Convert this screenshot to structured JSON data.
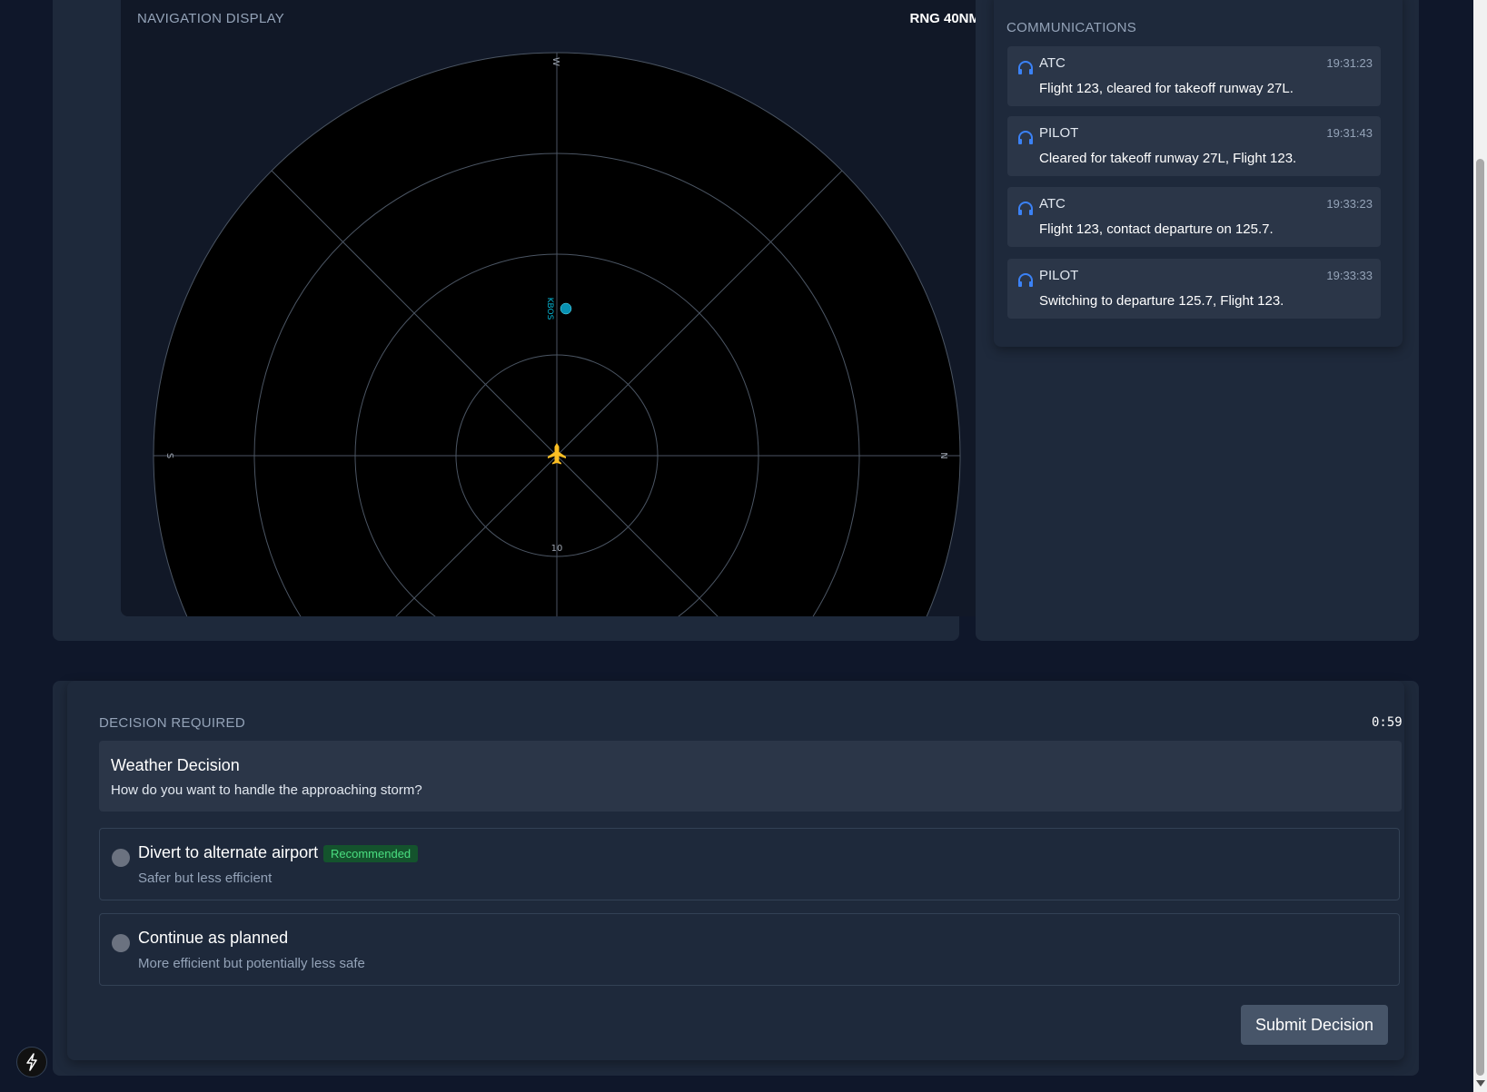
{
  "nav": {
    "title": "NAVIGATION DISPLAY",
    "range": "RNG 40NM",
    "compass": {
      "top": "W",
      "left": "S",
      "right": "N"
    },
    "ring_label": "10",
    "waypoint_label": "KBOS",
    "colors": {
      "aircraft": "#fbbf24",
      "waypoint": "#06b6d4",
      "grid": "#4b5563"
    }
  },
  "comms": {
    "title": "COMMUNICATIONS",
    "messages": [
      {
        "sender": "ATC",
        "time": "19:31:23",
        "text": "Flight 123, cleared for takeoff runway 27L."
      },
      {
        "sender": "PILOT",
        "time": "19:31:43",
        "text": "Cleared for takeoff runway 27L, Flight 123."
      },
      {
        "sender": "ATC",
        "time": "19:33:23",
        "text": "Flight 123, contact departure on 125.7."
      },
      {
        "sender": "PILOT",
        "time": "19:33:33",
        "text": "Switching to departure 125.7, Flight 123."
      }
    ],
    "icon": "headset-icon",
    "accent": "#3b82f6"
  },
  "decision": {
    "title": "DECISION REQUIRED",
    "timer": "0:59",
    "question_title": "Weather Decision",
    "question_text": "How do you want to handle the approaching storm?",
    "options": [
      {
        "label": "Divert to alternate airport",
        "badge": "Recommended",
        "desc": "Safer but less efficient"
      },
      {
        "label": "Continue as planned",
        "desc": "More efficient but potentially less safe"
      }
    ],
    "submit_label": "Submit Decision"
  },
  "dev_tool": {
    "icon": "bolt-icon"
  }
}
